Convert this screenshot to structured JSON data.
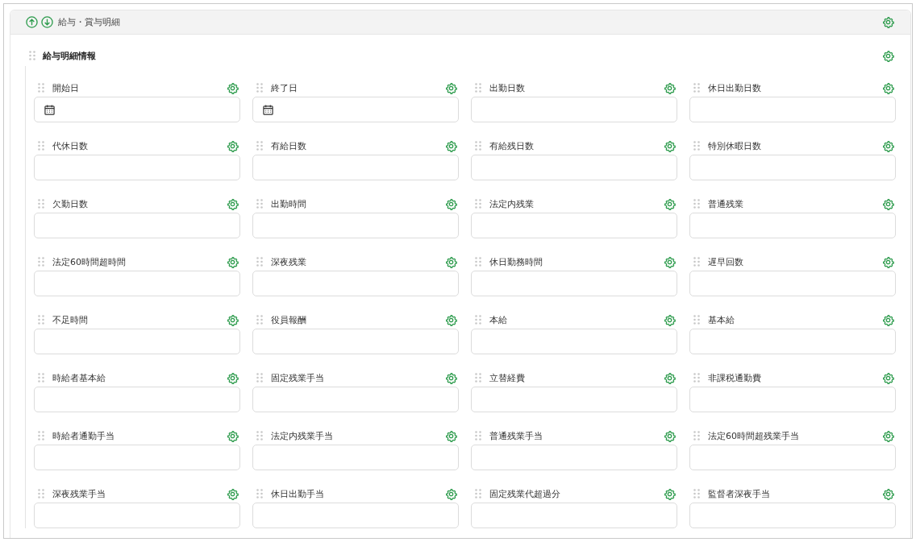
{
  "panel": {
    "title": "給与・賞与明細"
  },
  "section": {
    "title": "給与明細情報"
  },
  "fields": [
    {
      "label": "開始日",
      "kind": "date"
    },
    {
      "label": "終了日",
      "kind": "date"
    },
    {
      "label": "出勤日数",
      "kind": "text"
    },
    {
      "label": "休日出勤日数",
      "kind": "text"
    },
    {
      "label": "代休日数",
      "kind": "text"
    },
    {
      "label": "有給日数",
      "kind": "text"
    },
    {
      "label": "有給残日数",
      "kind": "text"
    },
    {
      "label": "特別休暇日数",
      "kind": "text"
    },
    {
      "label": "欠勤日数",
      "kind": "text"
    },
    {
      "label": "出勤時間",
      "kind": "text"
    },
    {
      "label": "法定内残業",
      "kind": "text"
    },
    {
      "label": "普通残業",
      "kind": "text"
    },
    {
      "label": "法定60時間超時間",
      "kind": "text"
    },
    {
      "label": "深夜残業",
      "kind": "text"
    },
    {
      "label": "休日勤務時間",
      "kind": "text"
    },
    {
      "label": "遅早回数",
      "kind": "text"
    },
    {
      "label": "不足時間",
      "kind": "text"
    },
    {
      "label": "役員報酬",
      "kind": "text"
    },
    {
      "label": "本給",
      "kind": "text"
    },
    {
      "label": "基本給",
      "kind": "text"
    },
    {
      "label": "時給者基本給",
      "kind": "text"
    },
    {
      "label": "固定残業手当",
      "kind": "text"
    },
    {
      "label": "立替経費",
      "kind": "text"
    },
    {
      "label": "非課税通勤費",
      "kind": "text"
    },
    {
      "label": "時給者通勤手当",
      "kind": "text"
    },
    {
      "label": "法定内残業手当",
      "kind": "text"
    },
    {
      "label": "普通残業手当",
      "kind": "text"
    },
    {
      "label": "法定60時間超残業手当",
      "kind": "text"
    },
    {
      "label": "深夜残業手当",
      "kind": "text"
    },
    {
      "label": "休日出勤手当",
      "kind": "text"
    },
    {
      "label": "固定残業代超過分",
      "kind": "text"
    },
    {
      "label": "監督者深夜手当",
      "kind": "text"
    }
  ]
}
